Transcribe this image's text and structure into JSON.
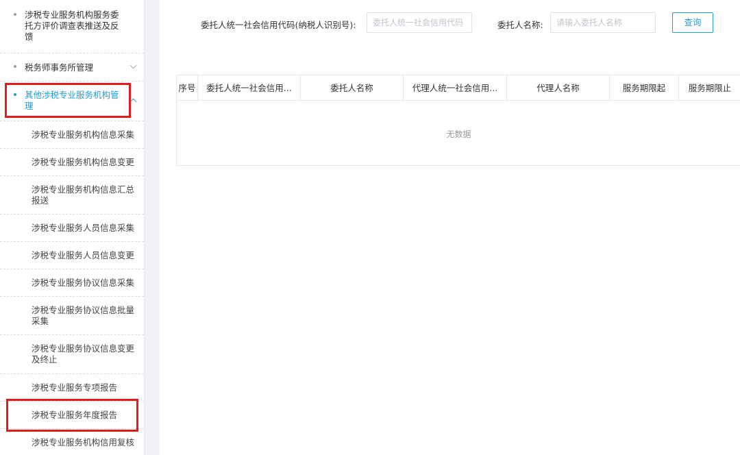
{
  "sidebar": {
    "items": [
      {
        "label": "涉税专业服务机构服务委托方评价调查表推送及反馈"
      },
      {
        "label": "税务师事务所管理"
      },
      {
        "label": "其他涉税专业服务机构管理"
      }
    ],
    "submenu": [
      {
        "label": "涉税专业服务机构信息采集"
      },
      {
        "label": "涉税专业服务机构信息变更"
      },
      {
        "label": "涉税专业服务机构信息汇总报送"
      },
      {
        "label": "涉税专业服务人员信息采集"
      },
      {
        "label": "涉税专业服务人员信息变更"
      },
      {
        "label": "涉税专业服务协议信息采集"
      },
      {
        "label": "涉税专业服务协议信息批量采集"
      },
      {
        "label": "涉税专业服务协议信息变更及终止"
      },
      {
        "label": "涉税专业服务专项报告"
      },
      {
        "label": "涉税专业服务年度报告"
      },
      {
        "label": "涉税专业服务机构信用复核"
      }
    ]
  },
  "search": {
    "credit_code_label": "委托人统一社会信用代码(纳税人识别号):",
    "credit_code_placeholder": "委托人统一社会信用代码",
    "name_label": "委托人名称:",
    "name_placeholder": "请输入委托人名称",
    "query_button": "查询"
  },
  "table": {
    "columns": [
      "序号",
      "委托人统一社会信用...",
      "委托人名称",
      "代理人统一社会信用...",
      "代理人名称",
      "服务期限起",
      "服务期限止"
    ],
    "empty_text": "无数据"
  }
}
